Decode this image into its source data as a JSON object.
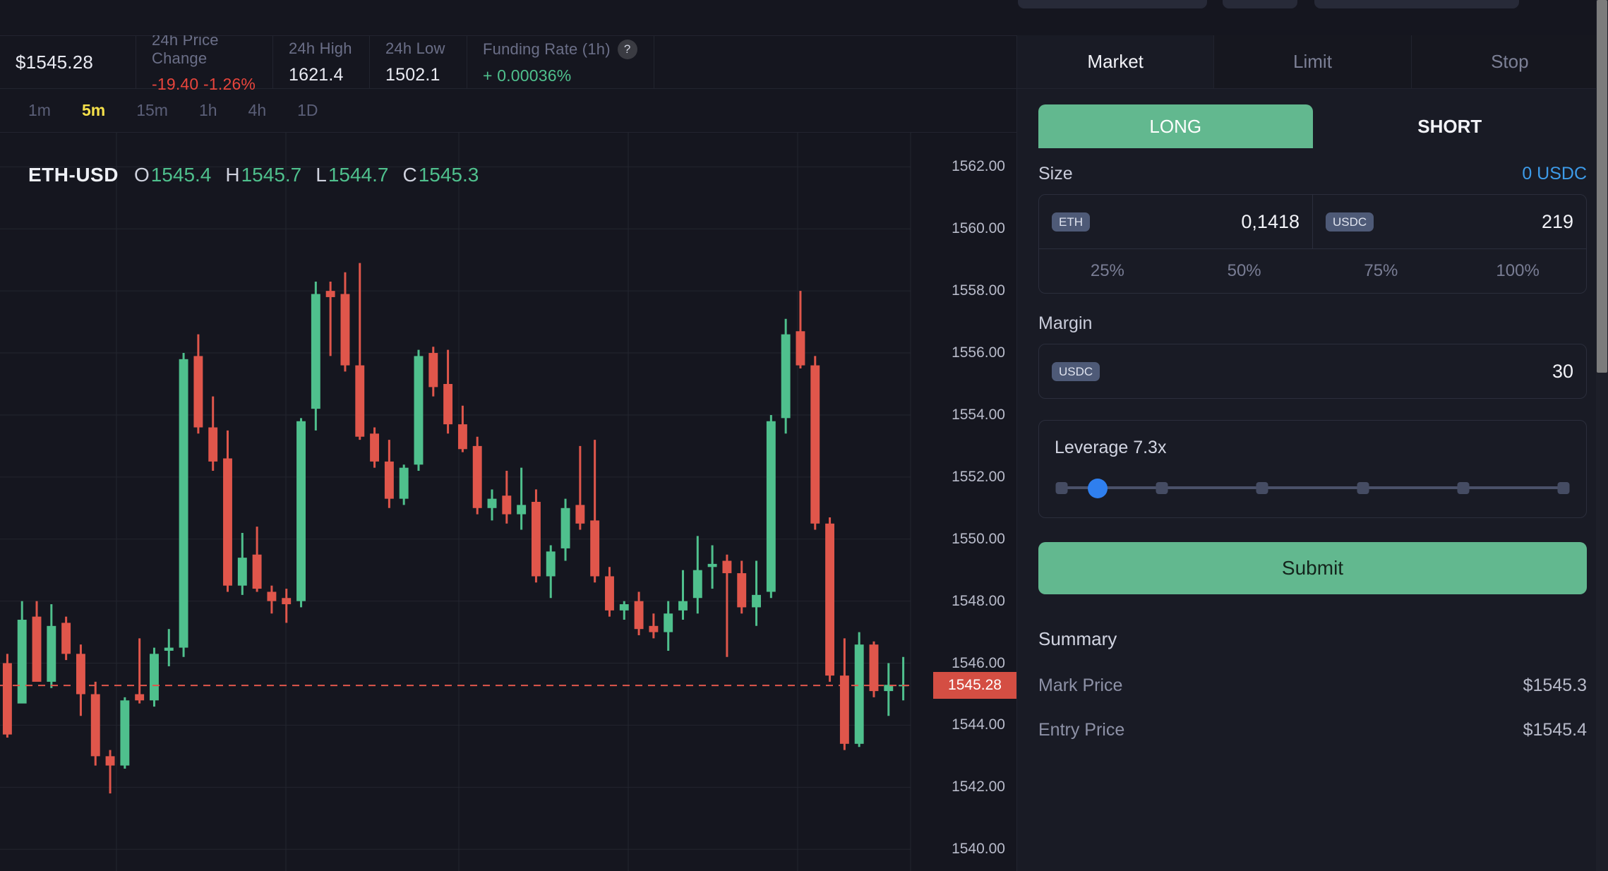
{
  "market": {
    "symbol": "ETH-USD",
    "last_price": "$1545.28",
    "stats": [
      {
        "label": "24h Price Change",
        "value": "-19.40 -1.26%",
        "tone": "neg"
      },
      {
        "label": "24h High",
        "value": "1621.4",
        "tone": "plain"
      },
      {
        "label": "24h Low",
        "value": "1502.1",
        "tone": "plain"
      },
      {
        "label": "Funding Rate (1h)",
        "value": "+ 0.00036%",
        "tone": "pos",
        "help": "?"
      }
    ]
  },
  "timeframes": {
    "items": [
      "1m",
      "5m",
      "15m",
      "1h",
      "4h",
      "1D"
    ],
    "active": "5m"
  },
  "ohlc": {
    "symbol": "ETH-USD",
    "o_label": "O",
    "o": "1545.4",
    "h_label": "H",
    "h": "1545.7",
    "l_label": "L",
    "l": "1544.7",
    "c_label": "C",
    "c": "1545.3"
  },
  "order": {
    "type_tabs": [
      {
        "label": "Market",
        "active": true
      },
      {
        "label": "Limit",
        "active": false
      },
      {
        "label": "Stop",
        "active": false
      }
    ],
    "sides": [
      {
        "label": "LONG",
        "selected": true
      },
      {
        "label": "SHORT",
        "selected": false
      }
    ],
    "size": {
      "label": "Size",
      "available": "0 USDC",
      "base_token": "ETH",
      "base_value": "0,1418",
      "quote_token": "USDC",
      "quote_value": "219",
      "percents": [
        "25%",
        "50%",
        "75%",
        "100%"
      ]
    },
    "margin": {
      "label": "Margin",
      "token": "USDC",
      "value": "30"
    },
    "leverage": {
      "label": "Leverage 7.3x",
      "value": 7.3,
      "ticks": 6,
      "thumb_pct": 7
    },
    "submit_label": "Submit",
    "summary": {
      "title": "Summary",
      "rows": [
        {
          "key": "Mark Price",
          "value": "$1545.3"
        },
        {
          "key": "Entry Price",
          "value": "$1545.4"
        }
      ]
    }
  },
  "chart_data": {
    "type": "candlestick",
    "title": "ETH-USD",
    "interval": "5m",
    "xlabel": "",
    "ylabel": "",
    "ylim": [
      1539.3,
      1563.1
    ],
    "grid": true,
    "y_ticks": [
      1540.0,
      1542.0,
      1544.0,
      1546.0,
      1548.0,
      1550.0,
      1552.0,
      1554.0,
      1556.0,
      1558.0,
      1560.0,
      1562.0
    ],
    "y_tick_labels": [
      "1540.00",
      "1542.00",
      "1544.00",
      "1546.00",
      "1548.00",
      "1550.00",
      "1552.00",
      "1554.00",
      "1556.00",
      "1558.00",
      "1560.00",
      "1562.00"
    ],
    "current_price": 1545.28,
    "current_price_label": "1545.28",
    "colors": {
      "up": "#4fc08d",
      "down": "#e0564b",
      "price_line": "#e0564b"
    },
    "candles": [
      {
        "o": 1546.0,
        "h": 1546.3,
        "l": 1543.6,
        "c": 1543.7
      },
      {
        "o": 1544.7,
        "h": 1548.0,
        "l": 1545.6,
        "c": 1547.4
      },
      {
        "o": 1547.5,
        "h": 1548.0,
        "l": 1545.5,
        "c": 1545.4
      },
      {
        "o": 1545.4,
        "h": 1547.9,
        "l": 1545.2,
        "c": 1547.2
      },
      {
        "o": 1547.3,
        "h": 1547.5,
        "l": 1546.1,
        "c": 1546.3
      },
      {
        "o": 1546.3,
        "h": 1546.6,
        "l": 1544.3,
        "c": 1545.0
      },
      {
        "o": 1545.0,
        "h": 1545.4,
        "l": 1542.7,
        "c": 1543.0
      },
      {
        "o": 1543.0,
        "h": 1543.2,
        "l": 1541.8,
        "c": 1542.7
      },
      {
        "o": 1542.7,
        "h": 1544.9,
        "l": 1542.6,
        "c": 1544.8
      },
      {
        "o": 1545.0,
        "h": 1546.8,
        "l": 1544.7,
        "c": 1544.8
      },
      {
        "o": 1544.8,
        "h": 1546.5,
        "l": 1544.6,
        "c": 1546.3
      },
      {
        "o": 1546.4,
        "h": 1547.1,
        "l": 1545.9,
        "c": 1546.5
      },
      {
        "o": 1546.5,
        "h": 1556.0,
        "l": 1546.2,
        "c": 1555.8
      },
      {
        "o": 1555.9,
        "h": 1556.6,
        "l": 1553.4,
        "c": 1553.6
      },
      {
        "o": 1553.6,
        "h": 1554.6,
        "l": 1552.2,
        "c": 1552.5
      },
      {
        "o": 1552.6,
        "h": 1553.5,
        "l": 1548.3,
        "c": 1548.5
      },
      {
        "o": 1548.5,
        "h": 1550.2,
        "l": 1548.2,
        "c": 1549.4
      },
      {
        "o": 1549.5,
        "h": 1550.4,
        "l": 1548.3,
        "c": 1548.4
      },
      {
        "o": 1548.3,
        "h": 1548.5,
        "l": 1547.6,
        "c": 1548.0
      },
      {
        "o": 1548.1,
        "h": 1548.4,
        "l": 1547.3,
        "c": 1547.9
      },
      {
        "o": 1548.0,
        "h": 1553.9,
        "l": 1547.8,
        "c": 1553.8
      },
      {
        "o": 1554.2,
        "h": 1558.3,
        "l": 1553.5,
        "c": 1557.9
      },
      {
        "o": 1558.0,
        "h": 1558.3,
        "l": 1555.9,
        "c": 1557.8
      },
      {
        "o": 1557.9,
        "h": 1558.6,
        "l": 1555.4,
        "c": 1555.6
      },
      {
        "o": 1555.6,
        "h": 1558.9,
        "l": 1553.2,
        "c": 1553.3
      },
      {
        "o": 1553.4,
        "h": 1553.6,
        "l": 1552.3,
        "c": 1552.5
      },
      {
        "o": 1552.5,
        "h": 1553.2,
        "l": 1551.0,
        "c": 1551.3
      },
      {
        "o": 1551.3,
        "h": 1552.4,
        "l": 1551.1,
        "c": 1552.3
      },
      {
        "o": 1552.4,
        "h": 1556.1,
        "l": 1552.2,
        "c": 1555.9
      },
      {
        "o": 1556.0,
        "h": 1556.2,
        "l": 1554.6,
        "c": 1554.9
      },
      {
        "o": 1555.0,
        "h": 1556.1,
        "l": 1553.4,
        "c": 1553.7
      },
      {
        "o": 1553.7,
        "h": 1554.3,
        "l": 1552.8,
        "c": 1552.9
      },
      {
        "o": 1553.0,
        "h": 1553.3,
        "l": 1550.8,
        "c": 1551.0
      },
      {
        "o": 1551.0,
        "h": 1551.6,
        "l": 1550.6,
        "c": 1551.3
      },
      {
        "o": 1551.4,
        "h": 1552.2,
        "l": 1550.5,
        "c": 1550.8
      },
      {
        "o": 1550.8,
        "h": 1552.3,
        "l": 1550.3,
        "c": 1551.1
      },
      {
        "o": 1551.2,
        "h": 1551.6,
        "l": 1548.6,
        "c": 1548.8
      },
      {
        "o": 1548.8,
        "h": 1549.8,
        "l": 1548.1,
        "c": 1549.6
      },
      {
        "o": 1549.7,
        "h": 1551.3,
        "l": 1549.3,
        "c": 1551.0
      },
      {
        "o": 1551.1,
        "h": 1553.0,
        "l": 1550.3,
        "c": 1550.5
      },
      {
        "o": 1550.6,
        "h": 1553.2,
        "l": 1548.6,
        "c": 1548.8
      },
      {
        "o": 1548.8,
        "h": 1549.1,
        "l": 1547.5,
        "c": 1547.7
      },
      {
        "o": 1547.7,
        "h": 1548.0,
        "l": 1547.4,
        "c": 1547.9
      },
      {
        "o": 1548.0,
        "h": 1548.3,
        "l": 1546.9,
        "c": 1547.1
      },
      {
        "o": 1547.2,
        "h": 1547.6,
        "l": 1546.8,
        "c": 1547.0
      },
      {
        "o": 1547.0,
        "h": 1548.0,
        "l": 1546.4,
        "c": 1547.6
      },
      {
        "o": 1547.7,
        "h": 1549.0,
        "l": 1547.4,
        "c": 1548.0
      },
      {
        "o": 1548.1,
        "h": 1550.1,
        "l": 1547.6,
        "c": 1549.0
      },
      {
        "o": 1549.1,
        "h": 1549.8,
        "l": 1548.4,
        "c": 1549.2
      },
      {
        "o": 1549.3,
        "h": 1549.5,
        "l": 1546.2,
        "c": 1548.9
      },
      {
        "o": 1548.9,
        "h": 1549.3,
        "l": 1547.6,
        "c": 1547.8
      },
      {
        "o": 1547.8,
        "h": 1549.3,
        "l": 1547.2,
        "c": 1548.2
      },
      {
        "o": 1548.3,
        "h": 1554.0,
        "l": 1548.1,
        "c": 1553.8
      },
      {
        "o": 1553.9,
        "h": 1557.1,
        "l": 1553.4,
        "c": 1556.6
      },
      {
        "o": 1556.7,
        "h": 1558.0,
        "l": 1555.5,
        "c": 1555.6
      },
      {
        "o": 1555.6,
        "h": 1555.9,
        "l": 1550.3,
        "c": 1550.5
      },
      {
        "o": 1550.5,
        "h": 1550.7,
        "l": 1545.4,
        "c": 1545.6
      },
      {
        "o": 1545.6,
        "h": 1546.8,
        "l": 1543.2,
        "c": 1543.4
      },
      {
        "o": 1543.4,
        "h": 1547.0,
        "l": 1543.3,
        "c": 1546.6
      },
      {
        "o": 1546.6,
        "h": 1546.7,
        "l": 1544.9,
        "c": 1545.1
      },
      {
        "o": 1545.1,
        "h": 1546.0,
        "l": 1544.3,
        "c": 1545.3
      },
      {
        "o": 1545.3,
        "h": 1546.2,
        "l": 1544.8,
        "c": 1545.3
      }
    ]
  }
}
